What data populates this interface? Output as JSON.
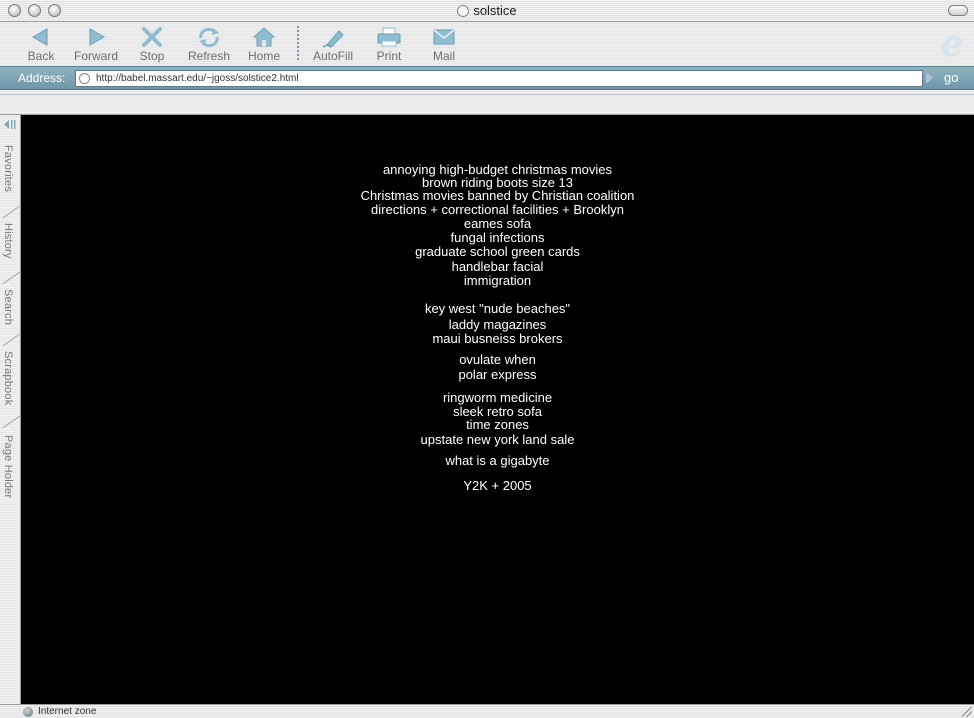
{
  "window": {
    "title": "solstice"
  },
  "toolbar": {
    "back": "Back",
    "forward": "Forward",
    "stop": "Stop",
    "refresh": "Refresh",
    "home": "Home",
    "autofill": "AutoFill",
    "print": "Print",
    "mail": "Mail"
  },
  "address": {
    "label": "Address:",
    "url": "http://babel.massart.edu/~jgoss/solstice2.html",
    "go": "go"
  },
  "sidebar": {
    "tabs": [
      "Favorites",
      "History",
      "Search",
      "Scrapbook",
      "Page Holder"
    ]
  },
  "content": {
    "queries": [
      "annoying high-budget christmas movies",
      "brown riding boots size 13",
      "Christmas movies banned by Christian coalition",
      "directions + correctional facilities + Brooklyn",
      "eames sofa",
      "fungal infections",
      "graduate school green cards",
      "handlebar facial",
      "immigration",
      "key west \"nude beaches\"",
      "laddy magazines",
      "maui busneiss brokers",
      "ovulate when",
      "polar express",
      "ringworm medicine",
      "sleek retro sofa",
      "time zones",
      "upstate new york land sale",
      "what is a gigabyte",
      "Y2K + 2005"
    ]
  },
  "status": {
    "text": "Internet zone"
  },
  "colors": {
    "accent": "#6d98a8",
    "content_bg": "#000000",
    "content_text": "#ffffff"
  }
}
